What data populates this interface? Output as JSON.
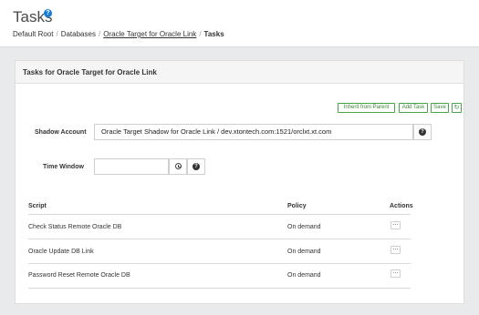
{
  "header": {
    "title": "Tasks",
    "help_icon": "question-circle-icon",
    "breadcrumb": {
      "item_1": "Default Root",
      "item_2": "Databases",
      "item_3": "Oracle Target for Oracle Link",
      "item_4": "Tasks",
      "separator": "/"
    }
  },
  "panel": {
    "title": "Tasks for Oracle Target for Oracle Link",
    "buttons": {
      "inherit": "Inherit from Parent",
      "add_task": "Add Task",
      "save": "Save",
      "refresh_icon": "refresh-icon",
      "refresh_glyph": "↻"
    },
    "accent_color": "#4aa34a"
  },
  "form": {
    "shadow_account_label": "Shadow Account",
    "shadow_account_value": "Oracle Target Shadow for Oracle Link / dev.xtontech.com:1521/orclxt.xt.com",
    "time_window_label": "Time Window",
    "time_window_value": "",
    "help_glyph": "?",
    "clock_icon": "clock-icon"
  },
  "table": {
    "columns": {
      "script": "Script",
      "policy": "Policy",
      "actions": "Actions"
    },
    "actions_glyph": "...",
    "rows": [
      {
        "script": "Check Status Remote Oracle DB",
        "policy": "On demand"
      },
      {
        "script": "Oracle Update DB Link",
        "policy": "On demand"
      },
      {
        "script": "Password Reset Remote Oracle DB",
        "policy": "On demand"
      }
    ]
  }
}
